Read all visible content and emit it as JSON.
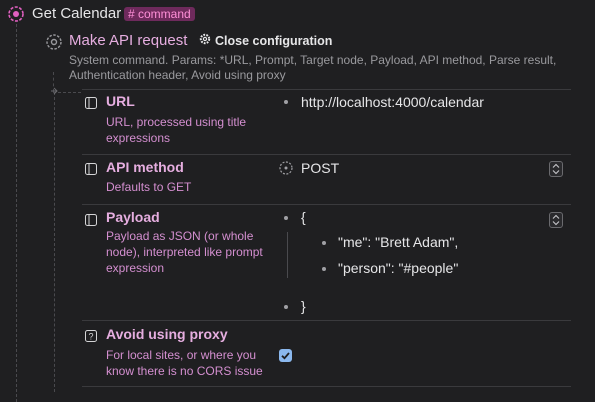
{
  "root": {
    "title": "Get Calendar",
    "tag": "# command"
  },
  "api_request": {
    "title": "Make API request",
    "close_config_label": "Close configuration",
    "description": "System command. Params: *URL, Prompt, Target node, Payload, API method, Parse result, Authentication header, Avoid using proxy"
  },
  "properties": {
    "url": {
      "name": "URL",
      "description": "URL, processed using title expressions",
      "value": "http://localhost:4000/calendar"
    },
    "api_method": {
      "name": "API method",
      "description": "Defaults to GET",
      "value": "POST"
    },
    "payload": {
      "name": "Payload",
      "description": "Payload as JSON (or whole node), interpreted like prompt expression",
      "open_brace": "{",
      "lines": [
        "\"me\": \"Brett Adam\",",
        "\"person\": \"#people\""
      ],
      "close_brace": "}"
    },
    "avoid_proxy": {
      "name": "Avoid using proxy",
      "description": "For local sites, or where you know there is no CORS issue",
      "checked": true
    }
  },
  "colors": {
    "background": "#1f1f21",
    "accent_pink": "#e6aee0",
    "badge_bg": "#6e2a5c",
    "badge_text": "#ff8fd8",
    "checkbox": "#8bb8ee"
  },
  "icons": {
    "root": "command-icon",
    "api": "gear-dashed-icon",
    "close": "gear-icon",
    "prop": "sidebar-panel-icon",
    "help": "question-square-icon"
  }
}
